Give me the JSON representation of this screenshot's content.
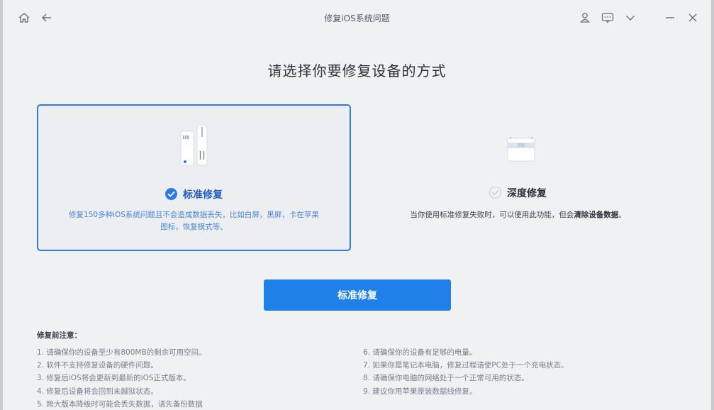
{
  "window": {
    "title": "修复iOS系统问题"
  },
  "titlebar_icons": [
    "home-icon",
    "back-arrow-icon",
    "user-icon",
    "feedback-icon",
    "dropdown-icon",
    "minimize-icon",
    "close-icon"
  ],
  "heading": "请选择你要修复设备的方式",
  "cards": {
    "standard": {
      "name": "标准修复",
      "selected": true,
      "description": "修复150多种iOS系统问题且不会造成数据丢失，比如白屏，黑屏，卡在苹果图标，恢复模式等。"
    },
    "deep": {
      "name": "深度修复",
      "selected": false,
      "description_prefix": "当你使用标准修复失败时，可以使用此功能，但会",
      "description_bold": "清除设备数据",
      "description_suffix": "。"
    }
  },
  "action_button": "标准修复",
  "notes": {
    "title": "修复前注意：",
    "left": [
      "1.  请确保你的设备至少有800MB的剩余可用空间。",
      "2.  软件不支持修复设备的硬件问题。",
      "3.  修复后iOS将会更新到最新的iOS正式版本。",
      "4.  修复后设备将会回到未越狱状态。",
      "5.  跨大版本降级时可能会丢失数据，请先备份数据"
    ],
    "right": [
      "6.  请确保你的设备有足够的电量。",
      "7.  如果你是笔记本电脑，修复过程请使PC处于一个充电状态。",
      "8.  请确保你电脑的网络处于一个正常可用的状态。",
      "9.  建议你用苹果原装数据线修复。"
    ]
  },
  "colors": {
    "accent": "#1f80e8",
    "selected_border": "#2d7ae6",
    "background": "#f0f1f3"
  }
}
